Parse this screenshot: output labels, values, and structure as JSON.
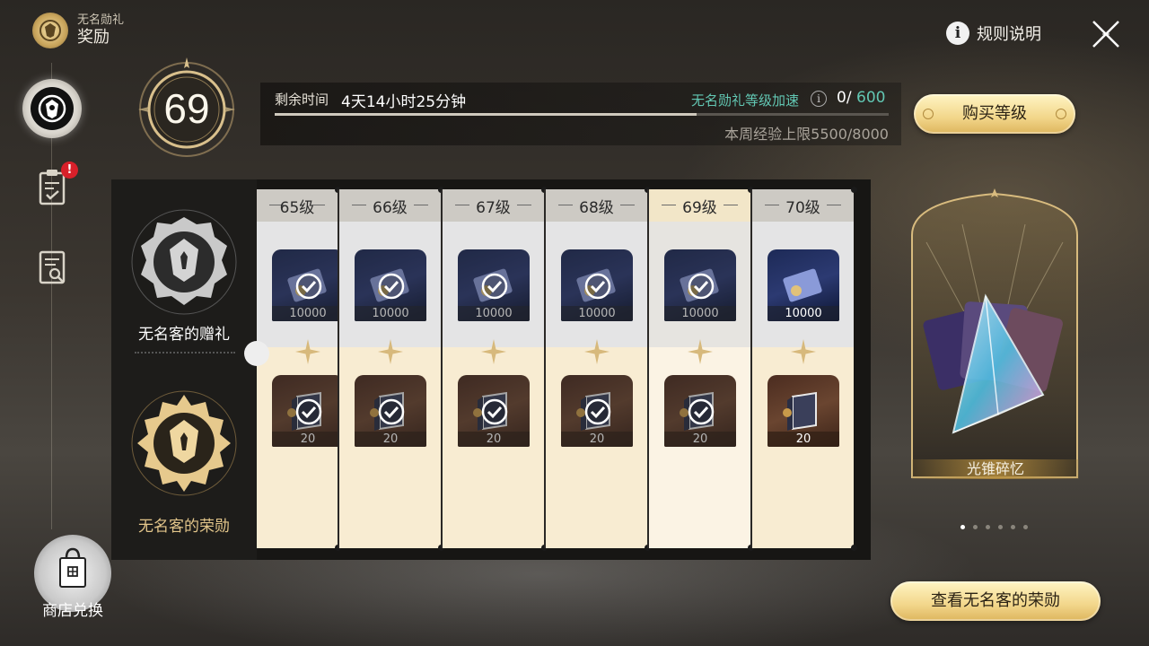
{
  "header": {
    "subtitle": "无名勋礼",
    "title": "奖励",
    "rules_label": "规则说明"
  },
  "nav": {
    "badge": "!",
    "shop_label": "商店兑换"
  },
  "level": {
    "current": "69",
    "time_label": "剩余时间",
    "time_remaining": "4天14小时25分钟",
    "boost_label": "无名勋礼等级加速",
    "boost_current": "0/",
    "boost_max": "600",
    "weekly_exp": "本周经验上限5500/8000",
    "weekly_progress": 0.6875,
    "buy_button": "购买等级"
  },
  "tracks": {
    "free_label": "无名客的赠礼",
    "paid_label": "无名客的荣勋"
  },
  "columns": [
    {
      "level": "65级",
      "free_qty": "10000",
      "paid_qty": "20",
      "claimed": true
    },
    {
      "level": "66级",
      "free_qty": "10000",
      "paid_qty": "20",
      "claimed": true
    },
    {
      "level": "67级",
      "free_qty": "10000",
      "paid_qty": "20",
      "claimed": true
    },
    {
      "level": "68级",
      "free_qty": "10000",
      "paid_qty": "20",
      "claimed": true
    },
    {
      "level": "69级",
      "free_qty": "10000",
      "paid_qty": "20",
      "claimed": true,
      "current": true
    },
    {
      "level": "70级",
      "free_qty": "10000",
      "paid_qty": "20",
      "claimed": false
    }
  ],
  "featured": {
    "label": "光锥碎忆",
    "page_count": 6,
    "active_page": 1
  },
  "view_button": "查看无名客的荣勋",
  "colors": {
    "accent_gold": "#f2d68a",
    "boost_teal": "#62c7b3",
    "badge_red": "#d8202a"
  }
}
